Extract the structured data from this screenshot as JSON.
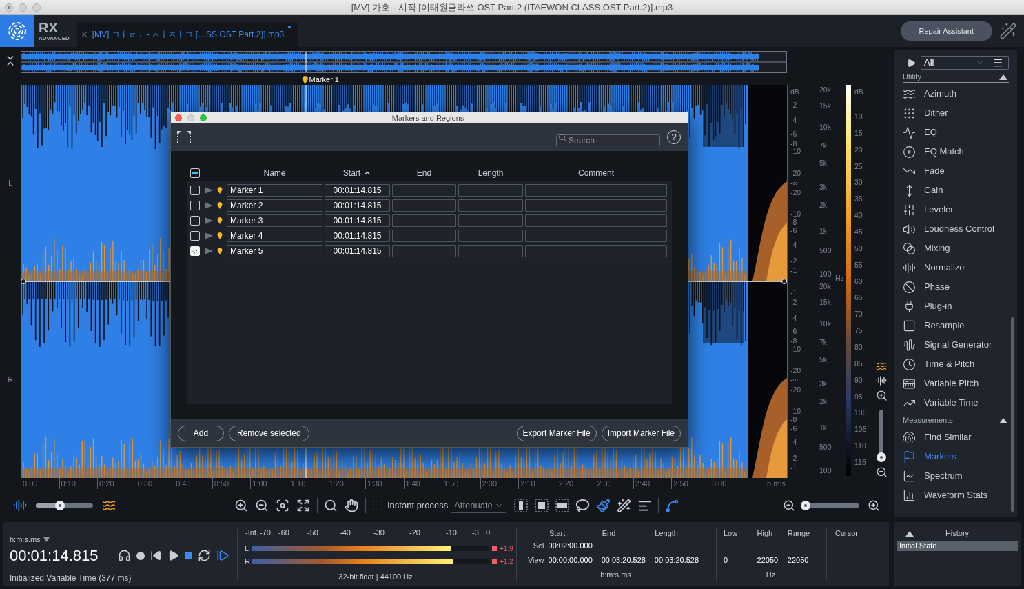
{
  "window": {
    "title": "[MV] 가호 - 시작 [이태원클라쓰 OST Part.2 (ITAEWON CLASS OST Part.2)].mp3"
  },
  "app": {
    "logo": "RX",
    "edition": "ADVANCED"
  },
  "file_tab": {
    "close": "×",
    "label": "[MV] ㄱㅏㅎㅗ - ㅅㅣㅈㅏㄱ […SS OST Part.2)].mp3",
    "modified": true
  },
  "repair_assistant": "Repair Assistant",
  "marker_flag": {
    "label": "Marker 1"
  },
  "channels": [
    {
      "label": "L",
      "db_scale": [
        "dB",
        "-2",
        "-4",
        "-6",
        "-8",
        "-10",
        "-20",
        "-∞",
        "-20",
        "-10",
        "-8",
        "-6",
        "-4",
        "-2",
        "-1"
      ],
      "hz_scale": [
        "20k",
        "15k",
        "10k",
        "7k",
        "5k",
        "3k",
        "2k",
        "1k",
        "500",
        "100"
      ]
    },
    {
      "label": "R",
      "db_scale": [
        "-1",
        "-2",
        "-4",
        "-6",
        "-8",
        "-10",
        "-20",
        "-∞",
        "-20",
        "-10",
        "-8",
        "-6",
        "-4",
        "-2",
        "-1"
      ],
      "hz_scale": [
        "20k",
        "15k",
        "10k",
        "7k",
        "5k",
        "3k",
        "2k",
        "1k",
        "500",
        "100"
      ]
    }
  ],
  "hz_unit": "Hz",
  "color_scale": [
    "dB",
    "10",
    "15",
    "20",
    "25",
    "30",
    "35",
    "40",
    "45",
    "50",
    "55",
    "60",
    "65",
    "70",
    "75",
    "80",
    "85",
    "90",
    "95",
    "100",
    "105",
    "110",
    "115"
  ],
  "freq_zoom": {
    "level": 0.02
  },
  "time_axis": {
    "ticks": [
      "0:00",
      "0:10",
      "0:20",
      "0:30",
      "0:40",
      "0:50",
      "1:00",
      "1:10",
      "1:20",
      "1:30",
      "1:40",
      "1:50",
      "2:00",
      "2:10",
      "2:20",
      "2:30",
      "2:40",
      "2:50",
      "3:00"
    ],
    "unit": "h:m:s"
  },
  "toolbar": {
    "view_blend": {
      "level": 0.42
    },
    "instant_process": {
      "label": "Instant process",
      "checked": false
    },
    "mode": "Attenuate",
    "zoom": {
      "level": 0.08
    }
  },
  "dialog": {
    "title": "Markers and Regions",
    "search_placeholder": "Search",
    "help": "?",
    "select_all": {
      "indeterminate": true
    },
    "columns": [
      {
        "label": "Name",
        "sorted": false
      },
      {
        "label": "Start",
        "sorted": true
      },
      {
        "label": "End",
        "sorted": false
      },
      {
        "label": "Length",
        "sorted": false
      },
      {
        "label": "Comment",
        "sorted": false
      }
    ],
    "rows": [
      {
        "checked": false,
        "name": "Marker 1",
        "start": "00:01:14.815"
      },
      {
        "checked": false,
        "name": "Marker 2",
        "start": "00:01:14.815"
      },
      {
        "checked": false,
        "name": "Marker 3",
        "start": "00:01:14.815"
      },
      {
        "checked": false,
        "name": "Marker 4",
        "start": "00:01:14.815"
      },
      {
        "checked": true,
        "name": "Marker 5",
        "start": "00:01:14.815"
      }
    ],
    "buttons_left": [
      "Add",
      "Remove selected"
    ],
    "buttons_right": [
      "Export Marker File",
      "Import Marker File"
    ]
  },
  "modules": {
    "filter": "All",
    "sections": [
      {
        "title": "Utility",
        "expanded": true,
        "items": [
          {
            "label": "Azimuth",
            "selected": false
          },
          {
            "label": "Dither",
            "selected": false
          },
          {
            "label": "EQ",
            "selected": false
          },
          {
            "label": "EQ Match",
            "selected": false
          },
          {
            "label": "Fade",
            "selected": false
          },
          {
            "label": "Gain",
            "selected": false
          },
          {
            "label": "Leveler",
            "selected": false
          },
          {
            "label": "Loudness Control",
            "selected": false
          },
          {
            "label": "Mixing",
            "selected": false
          },
          {
            "label": "Normalize",
            "selected": false
          },
          {
            "label": "Phase",
            "selected": false
          },
          {
            "label": "Plug-in",
            "selected": false
          },
          {
            "label": "Resample",
            "selected": false
          },
          {
            "label": "Signal Generator",
            "selected": false
          },
          {
            "label": "Time & Pitch",
            "selected": false
          },
          {
            "label": "Variable Pitch",
            "selected": false
          },
          {
            "label": "Variable Time",
            "selected": false
          }
        ]
      },
      {
        "title": "Measurements",
        "expanded": true,
        "items": [
          {
            "label": "Find Similar",
            "selected": false
          },
          {
            "label": "Markers",
            "selected": true
          },
          {
            "label": "Spectrum",
            "selected": false
          },
          {
            "label": "Waveform Stats",
            "selected": false
          }
        ]
      }
    ]
  },
  "transport": {
    "time_format": "h:m:s.ms",
    "time": "00:01:14.815",
    "status": "Initialized Variable Time (377 ms)"
  },
  "meters": {
    "scale": [
      "-Inf.",
      "-70",
      "-60",
      "-50",
      "-40",
      "-30",
      "-20",
      "-10",
      "-3",
      "0"
    ],
    "channels": [
      {
        "label": "L",
        "level": 0.84,
        "peak": "+1.9"
      },
      {
        "label": "R",
        "level": 0.85,
        "peak": "+1.2"
      }
    ],
    "format": "32-bit float | 44100 Hz"
  },
  "selection": {
    "headers": [
      "Start",
      "End",
      "Length"
    ],
    "rows": [
      {
        "label": "Sel",
        "start": "00:02:00.000"
      },
      {
        "label": "View",
        "start": "00:00:00.000",
        "end": "00:03:20.528",
        "length": "00:03:20.528"
      }
    ],
    "unit": "h:m:s.ms"
  },
  "frequency": {
    "headers": [
      "Low",
      "High",
      "Range"
    ],
    "values": [
      "0",
      "22050",
      "22050"
    ],
    "unit": "Hz"
  },
  "cursor": {
    "header": "Cursor"
  },
  "history": {
    "title": "History",
    "items": [
      {
        "label": "Initial State",
        "selected": true
      }
    ]
  }
}
